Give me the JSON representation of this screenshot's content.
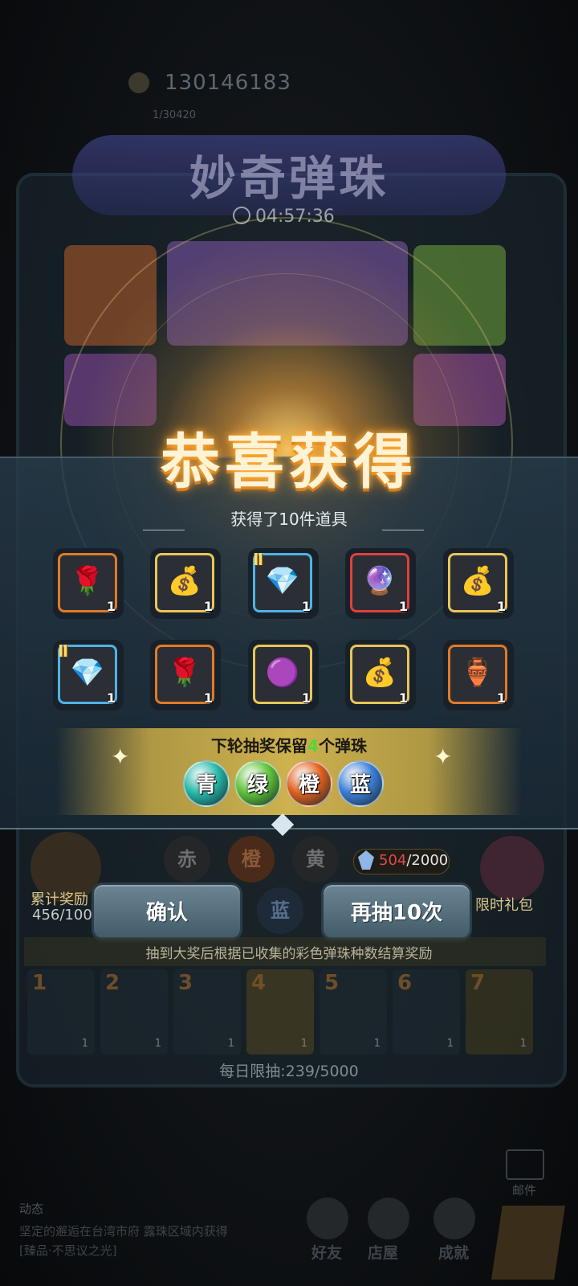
{
  "background": {
    "player_id": "130146183",
    "player_sub": "1/30420",
    "event_title": "妙奇弹珠",
    "timer": "04:57:36"
  },
  "popup": {
    "title": "恭喜获得",
    "subtitle": "获得了10件道具",
    "items": [
      {
        "icon": "rose-card-icon",
        "glyph": "🌹",
        "count": "1",
        "frame": "#e07a2a",
        "tier": ""
      },
      {
        "icon": "gold-bag-icon",
        "glyph": "💰",
        "count": "1",
        "frame": "#e9c559",
        "tier": ""
      },
      {
        "icon": "pink-gem-ball-icon",
        "glyph": "💎",
        "count": "1",
        "frame": "#4fb2e6",
        "tier": "Ⅱ"
      },
      {
        "icon": "rainbow-crest-icon",
        "glyph": "🔮",
        "count": "1",
        "frame": "#e0403a",
        "tier": ""
      },
      {
        "icon": "gold-bag-icon",
        "glyph": "💰",
        "count": "1",
        "frame": "#e9c559",
        "tier": ""
      },
      {
        "icon": "pink-gem-ball-icon",
        "glyph": "💎",
        "count": "1",
        "frame": "#4fb2e6",
        "tier": "Ⅱ"
      },
      {
        "icon": "rose-card-icon",
        "glyph": "🌹",
        "count": "1",
        "frame": "#e07a2a",
        "tier": ""
      },
      {
        "icon": "purple-orb-icon",
        "glyph": "🟣",
        "count": "1",
        "frame": "#e9c559",
        "tier": ""
      },
      {
        "icon": "gold-bag-icon",
        "glyph": "💰",
        "count": "1",
        "frame": "#e9c559",
        "tier": ""
      },
      {
        "icon": "six-gen-select-jar-icon",
        "glyph": "🏺",
        "count": "1",
        "frame": "#e07a2a",
        "tier": ""
      }
    ],
    "keep": {
      "prefix": "下轮抽奖保留",
      "num": "4",
      "suffix": "个弹珠"
    },
    "orbs": [
      {
        "label": "青",
        "color": "#27b8a8"
      },
      {
        "label": "绿",
        "color": "#5fc23a"
      },
      {
        "label": "橙",
        "color": "#e0601e"
      },
      {
        "label": "蓝",
        "color": "#3d7fd6"
      }
    ],
    "confirm_label": "确认",
    "redraw_label": "再抽10次"
  },
  "lower": {
    "accum_label": "累计奖励",
    "accum_value": "456/100",
    "marbles": [
      "赤",
      "橙",
      "黄",
      "蓝"
    ],
    "gem_current": "504",
    "gem_total": "/2000",
    "gift_label": "限时礼包",
    "reward_note": "抽到大奖后根据已收集的彩色弹珠种数结算奖励",
    "reward_slots": [
      {
        "n": "1",
        "count": "1"
      },
      {
        "n": "2",
        "count": "1"
      },
      {
        "n": "3",
        "count": "1"
      },
      {
        "n": "4",
        "count": "1"
      },
      {
        "n": "5",
        "count": "1"
      },
      {
        "n": "6",
        "count": "1"
      },
      {
        "n": "7",
        "count": "1"
      }
    ],
    "daily_limit": "每日限抽:239/5000"
  },
  "bottom": {
    "mail_label": "邮件",
    "news_title": "动态",
    "news_body": "坚定的邂逅在台湾市府 露珠区域内获得[臻品·不思议之光]",
    "nav": [
      "好友",
      "店屋",
      "成就"
    ]
  }
}
